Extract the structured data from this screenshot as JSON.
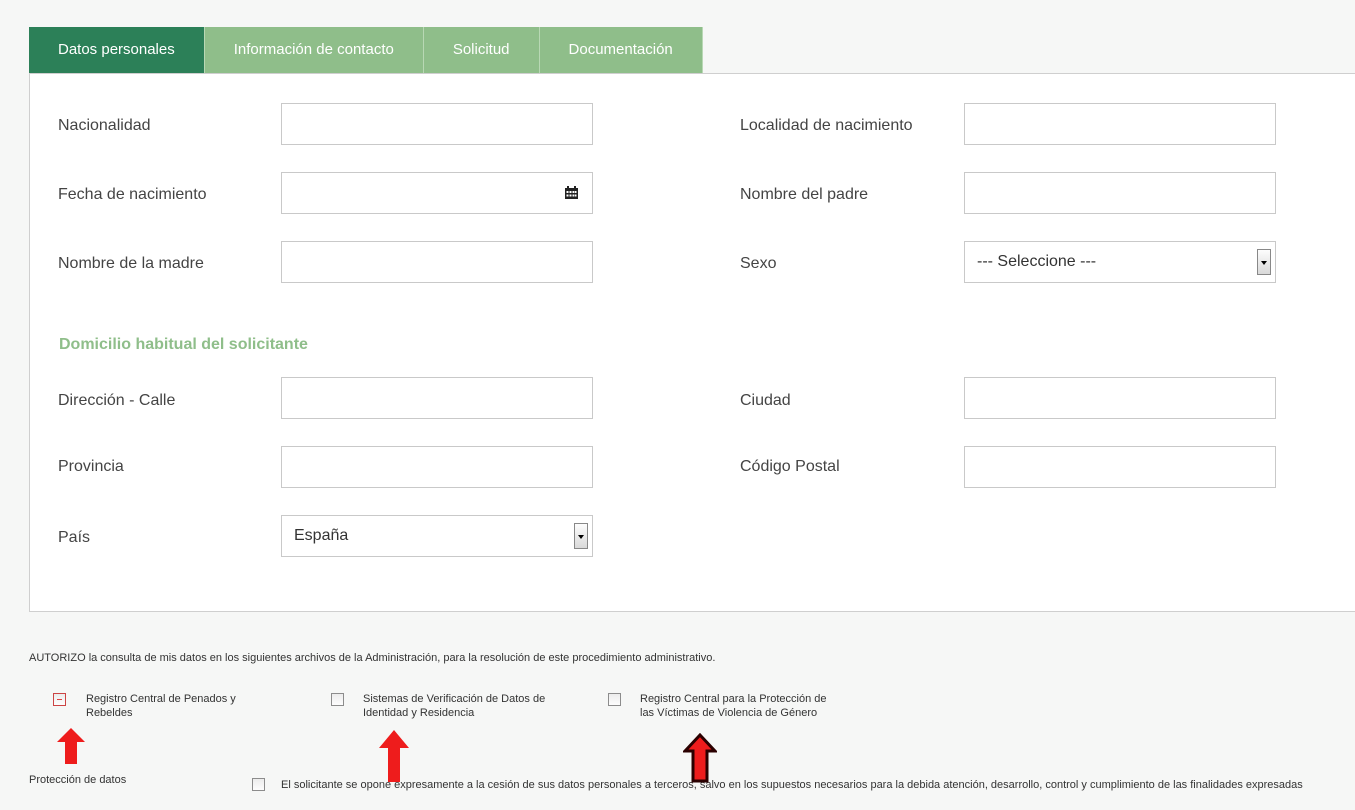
{
  "tabs": [
    "Datos personales",
    "Información de contacto",
    "Solicitud",
    "Documentación"
  ],
  "fields": {
    "nacionalidad": "Nacionalidad",
    "localidad": "Localidad de nacimiento",
    "fecha": "Fecha de nacimiento",
    "padre": "Nombre del padre",
    "madre": "Nombre de la madre",
    "sexo": "Sexo",
    "sexo_value": "--- Seleccione ---",
    "direccion": "Dirección - Calle",
    "ciudad": "Ciudad",
    "provincia": "Provincia",
    "cp": "Código Postal",
    "pais": "País",
    "pais_value": "España"
  },
  "section_title": "Domicilio habitual del solicitante",
  "authorize_text": "AUTORIZO la consulta de mis datos en los siguientes archivos de la Administración, para la resolución de este procedimiento administrativo.",
  "checkboxes": [
    "Registro Central de Penados y Rebeldes",
    "Sistemas de Verificación de Datos de Identidad y Residencia",
    "Registro Central para la Protección de las Víctimas de Violencia de Género"
  ],
  "data_protection_label": "Protección de datos",
  "data_protection_text": "El solicitante se opone expresamente a la cesión de sus datos personales a terceros, salvo en los supuestos necesarios para la debida atención, desarrollo, control y cumplimiento de las finalidades expresadas",
  "colors": {
    "tab_active": "#2c8058",
    "tab": "#8fbe8a",
    "annotation_red": "#ee1c1c",
    "annotation_dark": "#2a0000"
  },
  "icons": {
    "date": "calendar-icon",
    "dropdown": "chevron-down-icon",
    "annotation": "arrow-up-icon"
  }
}
